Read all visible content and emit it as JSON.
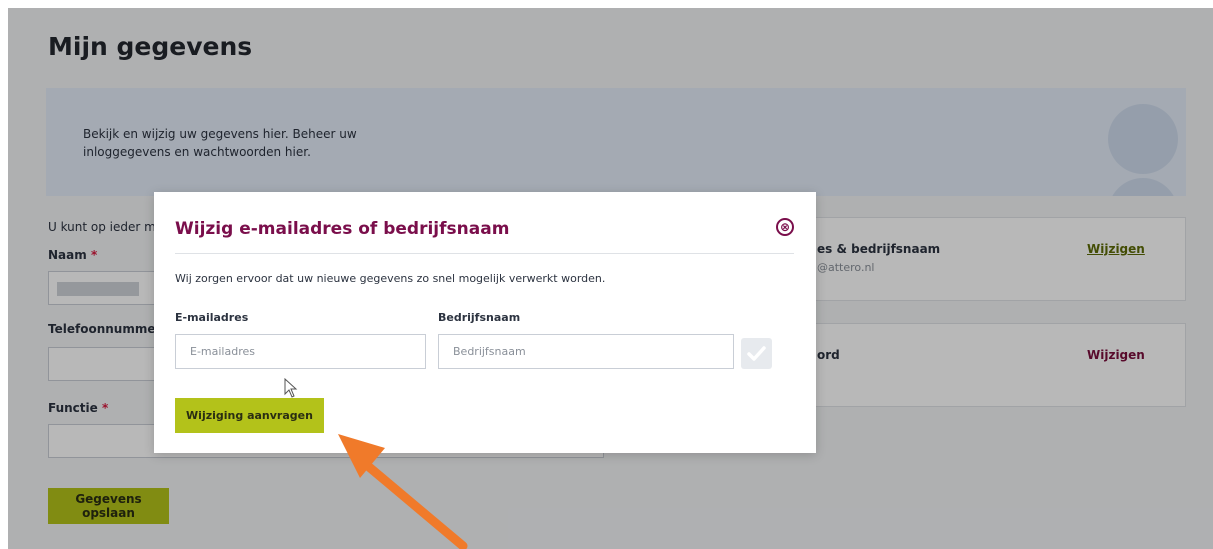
{
  "page": {
    "title": "Mijn gegevens",
    "banner_text": "Bekijk en wijzig uw gegevens hier. Beheer uw inloggegevens en wachtwoorden hier.",
    "intro_partial": "U kunt op ieder mo",
    "fields": {
      "name_label": "Naam",
      "phone_label": "Telefoonnummer",
      "function_label": "Functie",
      "required_marker": "*"
    },
    "save_button": "Gegevens opslaan"
  },
  "cards": [
    {
      "title": "es & bedrijfsnaam",
      "subtitle": "@attero.nl",
      "action": "Wijzigen"
    },
    {
      "title": "ord",
      "action": "Wijzigen"
    }
  ],
  "modal": {
    "title": "Wijzig e-mailadres of bedrijfsnaam",
    "close_icon": "⊗",
    "description": "Wij zorgen ervoor dat uw nieuwe gegevens zo snel mogelijk verwerkt worden.",
    "email_label": "E-mailadres",
    "email_placeholder": "E-mailadres",
    "company_label": "Bedrijfsnaam",
    "company_placeholder": "Bedrijfsnaam",
    "submit_button": "Wijziging aanvragen"
  },
  "colors": {
    "accent_green": "#b3c21a",
    "brand_purple": "#7a0e4b",
    "annotation_arrow": "#f07a2a"
  }
}
